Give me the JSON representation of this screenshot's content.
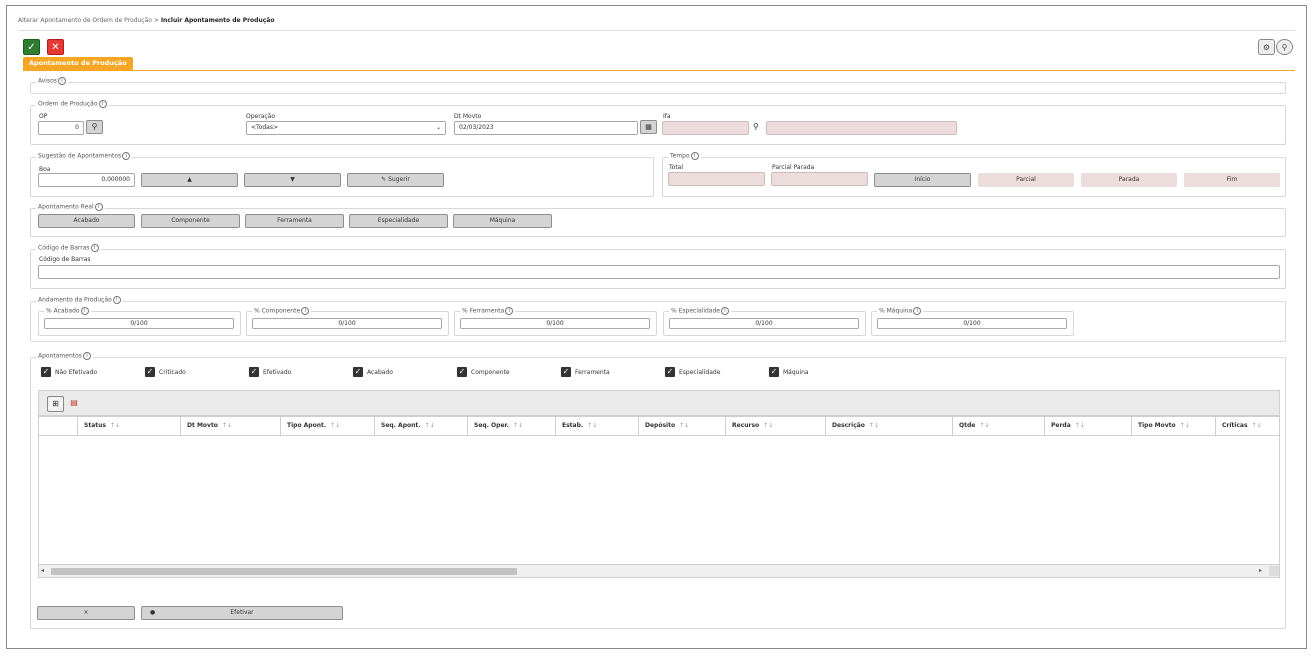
{
  "breadcrumb": {
    "parent": "Alterar Apontamento de Ordem de Produção",
    "separator": ">",
    "current": "Incluir Apontamento de Produção"
  },
  "toolbar": {
    "confirm_icon": "✓",
    "cancel_icon": "✕",
    "settings_icon": "⚙",
    "search_icon": "⚲"
  },
  "tab": {
    "label": "Apontamento de Produção"
  },
  "avisos": {
    "legend": "Avisos"
  },
  "ordem": {
    "legend": "Ordem de Produção",
    "op_label": "OP",
    "op_value": "0",
    "operacao_label": "Operação",
    "operacao_value": "<Todas>",
    "dt_label": "Dt Movto",
    "dt_value": "02/03/2023",
    "ifa_label": "Ifa"
  },
  "sugestao": {
    "legend": "Sugestão de Apontamentos",
    "boa_label": "Boa",
    "boa_value": "0,000000",
    "up_label": "▲",
    "down_label": "▼",
    "sugerir_label": "Sugerir"
  },
  "tempo": {
    "legend": "Tempo",
    "total_label": "Total",
    "parcial_parada_label": "Parcial Parada",
    "inicio": "Início",
    "parcial": "Parcial",
    "parada": "Parada",
    "fim": "Fim"
  },
  "apontamento_real": {
    "legend": "Apontamento Real",
    "buttons": [
      "Acabado",
      "Componente",
      "Ferramenta",
      "Especialidade",
      "Máquina"
    ]
  },
  "codigo_barras": {
    "legend": "Código de Barras",
    "label": "Código de Barras"
  },
  "andamento": {
    "legend": "Andamento da Produção",
    "items": [
      {
        "label": "% Acabado",
        "value": "0/100"
      },
      {
        "label": "% Componente",
        "value": "0/100"
      },
      {
        "label": "% Ferramenta",
        "value": "0/100"
      },
      {
        "label": "% Especialidade",
        "value": "0/100"
      },
      {
        "label": "% Máquina",
        "value": "0/100"
      }
    ]
  },
  "apontamentos": {
    "legend": "Apontamentos",
    "filters": [
      "Não Efetivado",
      "Criticado",
      "Efetivado",
      "Acabado",
      "Componente",
      "Ferramenta",
      "Especialidade",
      "Máquina"
    ],
    "columns": [
      "Status",
      "Dt Movto",
      "Tipo Apont.",
      "Seq. Apont.",
      "Seq. Oper.",
      "Estab.",
      "Depósito",
      "Recurso",
      "Descrição",
      "Qtde",
      "Perda",
      "Tipo Movto",
      "Críticas"
    ],
    "sort_glyph": "↑↓"
  },
  "footer": {
    "remove_label": "×",
    "efetivar_label": "Efetivar"
  },
  "colors": {
    "tab_orange": "#f5a623",
    "confirm_green": "#2e7d32",
    "cancel_red": "#e53935",
    "readonly_pink": "#ecdcdc"
  }
}
